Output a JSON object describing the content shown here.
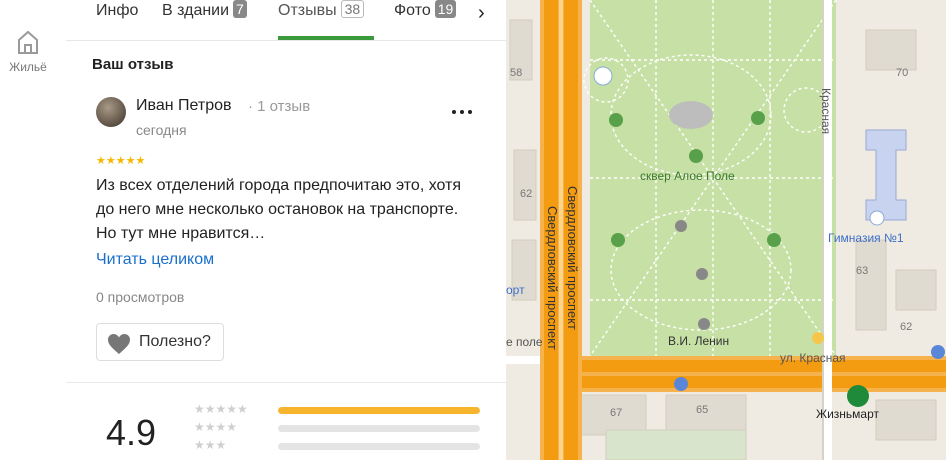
{
  "sidebar": {
    "items": [
      {
        "label": "Жильё",
        "icon": "house-icon"
      }
    ]
  },
  "tabs": [
    {
      "label": "Инфо",
      "count": ""
    },
    {
      "label": "В здании",
      "count": "7"
    },
    {
      "label": "Отзывы",
      "count": "38",
      "active": true
    },
    {
      "label": "Фото",
      "count": "19"
    }
  ],
  "review_section": {
    "title": "Ваш отзыв",
    "author": "Иван Петров",
    "author_reviews": "· 1 отзыв",
    "date": "сегодня",
    "stars": "★★★★★",
    "text": "Из всех отделений города предпочитаю это, хотя до него мне несколько остановок на транспорте. Но тут мне нравится…",
    "read_more": "Читать целиком",
    "views": "0 просмотров",
    "useful_label": "Полезно?"
  },
  "rating": {
    "value": "4.9",
    "distribution": [
      {
        "stars": "★★★★★",
        "fraction": 1.0
      },
      {
        "stars": "★★★★",
        "fraction": 0.0
      },
      {
        "stars": "★★★",
        "fraction": 0.0
      }
    ]
  },
  "map": {
    "labels": {
      "park": "сквер Алое Поле",
      "avenue": "Свердловский проспект",
      "street_vertical": "Красная",
      "street_horizontal": "ул. Красная",
      "school": "Гимназия №1",
      "lenin": "В.И. Ленин",
      "shop": "Жизньмарт",
      "edge_left_1": "орт",
      "edge_left_2": "е поле"
    },
    "house_numbers": [
      "58",
      "70",
      "62",
      "63",
      "62",
      "67",
      "65"
    ]
  },
  "colors": {
    "accent_green": "#3b9a3b",
    "link_blue": "#1a6fcc",
    "star_yellow": "#f5b800",
    "road_orange": "#f39c12",
    "park_green": "#c7e0a6"
  }
}
